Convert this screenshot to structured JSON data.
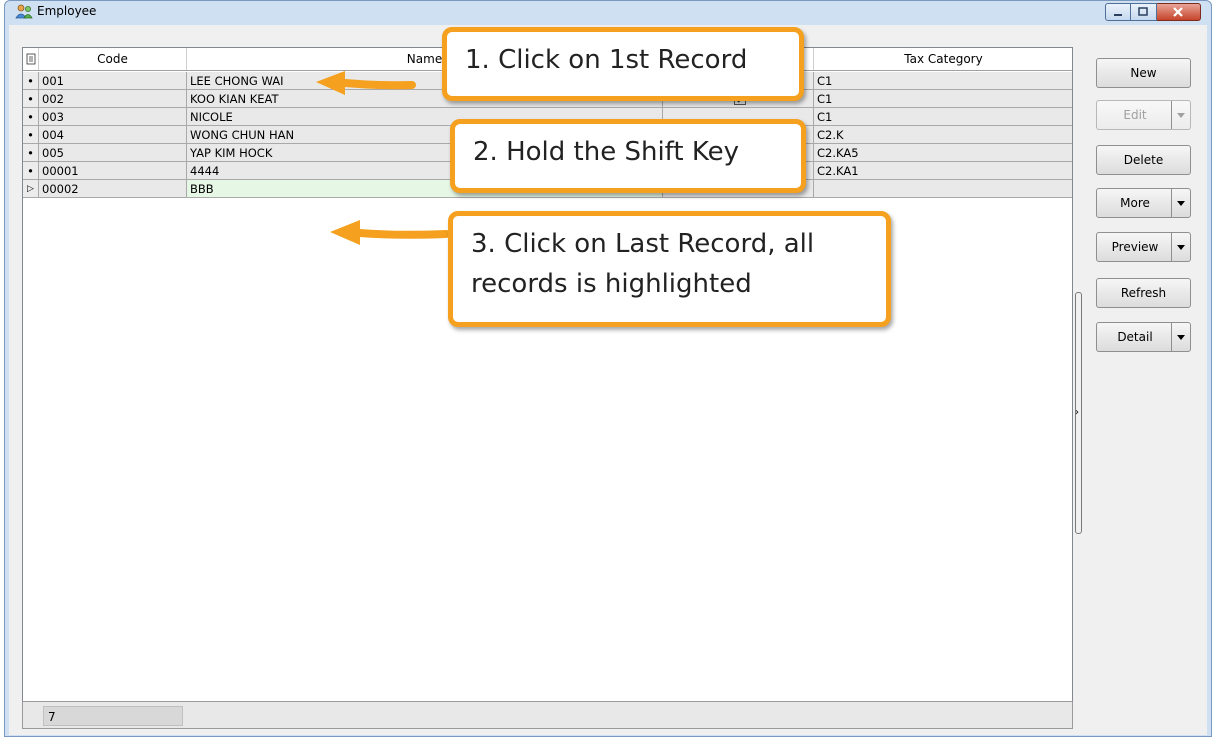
{
  "window": {
    "title": "Employee",
    "icon": "employee-icon"
  },
  "grid": {
    "columns": [
      "Code",
      "Name",
      "",
      "Tax Category"
    ],
    "rows": [
      {
        "code": "001",
        "name": "LEE CHONG WAI",
        "checked": false,
        "tax": "C1"
      },
      {
        "code": "002",
        "name": "KOO KIAN KEAT",
        "checked": true,
        "tax": "C1"
      },
      {
        "code": "003",
        "name": "NICOLE",
        "checked": false,
        "tax": "C1"
      },
      {
        "code": "004",
        "name": "WONG CHUN HAN",
        "checked": false,
        "tax": "C2.K"
      },
      {
        "code": "005",
        "name": "YAP KIM HOCK",
        "checked": false,
        "tax": "C2.KA5"
      },
      {
        "code": "00001",
        "name": "4444",
        "checked": true,
        "tax": "C2.KA1"
      },
      {
        "code": "00002",
        "name": "BBB",
        "checked": false,
        "tax": ""
      }
    ],
    "record_count": "7"
  },
  "toolbar": {
    "new_label": "New",
    "edit_label": "Edit",
    "delete_label": "Delete",
    "more_label": "More",
    "preview_label": "Preview",
    "refresh_label": "Refresh",
    "detail_label": "Detail"
  },
  "callouts": {
    "step1": "1. Click on 1st Record",
    "step2": "2. Hold the Shift Key",
    "step3_line1": "3. Click on Last Record, all",
    "step3_line2": "records is highlighted"
  },
  "colors": {
    "callout_border": "#f5a01e",
    "active_row": "#e6f7e6"
  }
}
